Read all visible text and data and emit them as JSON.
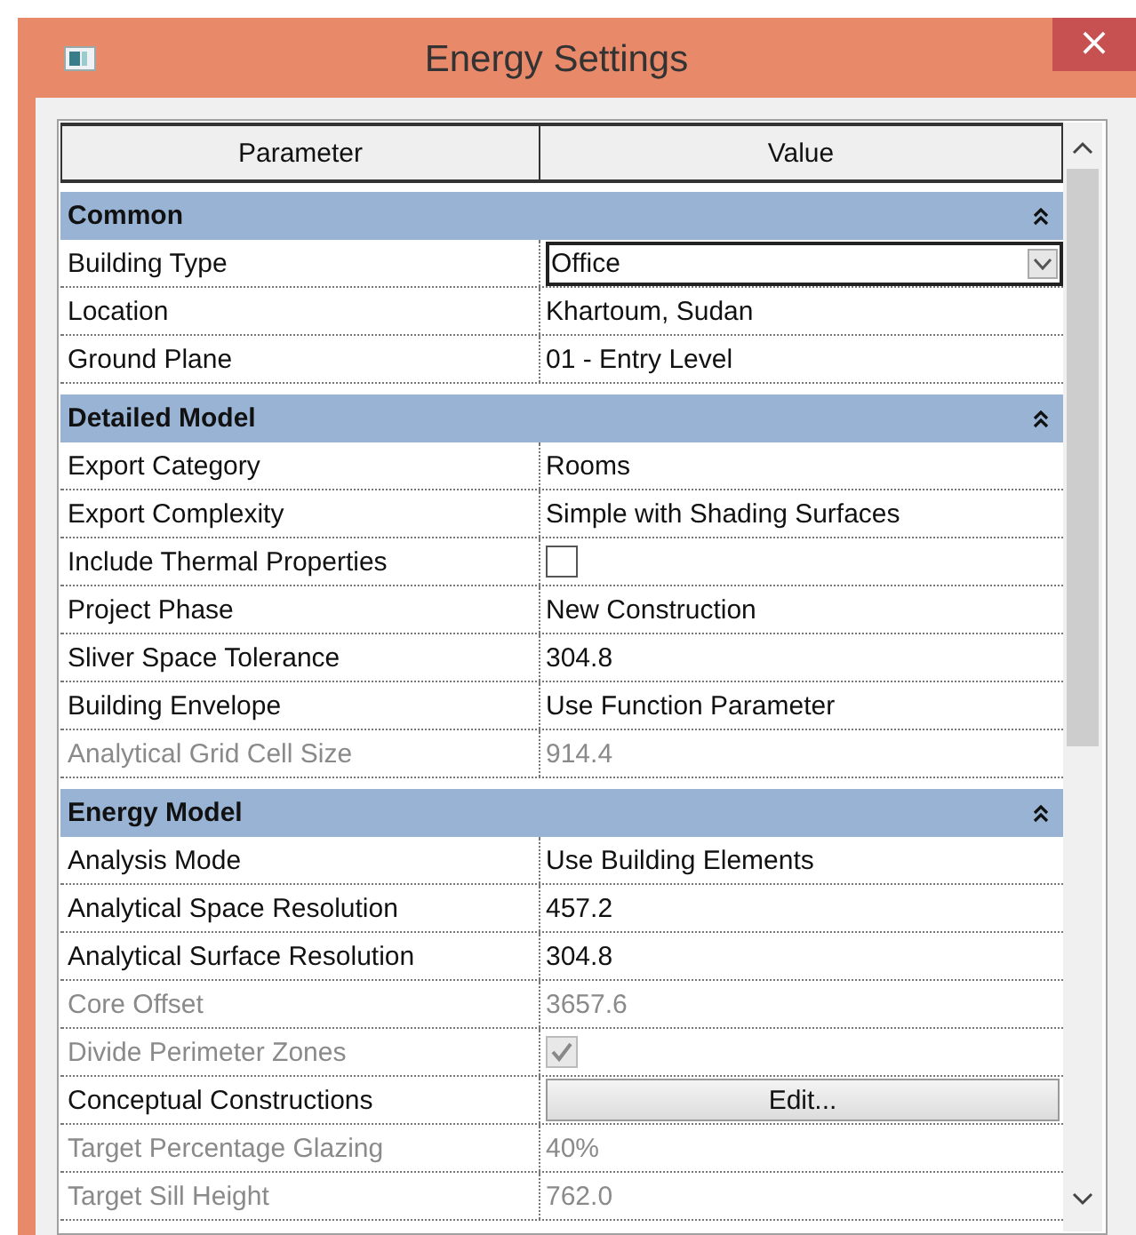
{
  "window": {
    "title": "Energy Settings",
    "close": "×"
  },
  "table": {
    "columns": [
      "Parameter",
      "Value"
    ],
    "groups": [
      {
        "title": "Common",
        "expanded": true,
        "rows": [
          {
            "name": "Building Type",
            "kind": "dropdown",
            "value": "Office",
            "disabled": false
          },
          {
            "name": "Location",
            "kind": "text",
            "value": "Khartoum, Sudan",
            "disabled": false
          },
          {
            "name": "Ground Plane",
            "kind": "text",
            "value": "01 - Entry Level",
            "disabled": false
          }
        ]
      },
      {
        "title": "Detailed Model",
        "expanded": true,
        "rows": [
          {
            "name": "Export Category",
            "kind": "text",
            "value": "Rooms",
            "disabled": false
          },
          {
            "name": "Export Complexity",
            "kind": "text",
            "value": "Simple with Shading Surfaces",
            "disabled": false
          },
          {
            "name": "Include Thermal Properties",
            "kind": "checkbox",
            "checked": false,
            "disabled": false
          },
          {
            "name": "Project Phase",
            "kind": "text",
            "value": "New Construction",
            "disabled": false
          },
          {
            "name": "Sliver Space Tolerance",
            "kind": "text",
            "value": "304.8",
            "disabled": false
          },
          {
            "name": "Building Envelope",
            "kind": "text",
            "value": "Use Function Parameter",
            "disabled": false
          },
          {
            "name": "Analytical Grid Cell Size",
            "kind": "text",
            "value": "914.4",
            "disabled": true
          }
        ]
      },
      {
        "title": "Energy Model",
        "expanded": true,
        "rows": [
          {
            "name": "Analysis Mode",
            "kind": "text",
            "value": "Use Building Elements",
            "disabled": false
          },
          {
            "name": "Analytical Space Resolution",
            "kind": "text",
            "value": "457.2",
            "disabled": false
          },
          {
            "name": "Analytical Surface Resolution",
            "kind": "text",
            "value": "304.8",
            "disabled": false
          },
          {
            "name": "Core Offset",
            "kind": "text",
            "value": "3657.6",
            "disabled": true
          },
          {
            "name": "Divide Perimeter Zones",
            "kind": "checkbox",
            "checked": true,
            "disabled": true
          },
          {
            "name": "Conceptual Constructions",
            "kind": "button",
            "value": "Edit...",
            "disabled": false
          },
          {
            "name": "Target Percentage Glazing",
            "kind": "text",
            "value": "40%",
            "disabled": true
          },
          {
            "name": "Target Sill Height",
            "kind": "text",
            "value": "762.0",
            "disabled": true
          }
        ]
      }
    ]
  }
}
